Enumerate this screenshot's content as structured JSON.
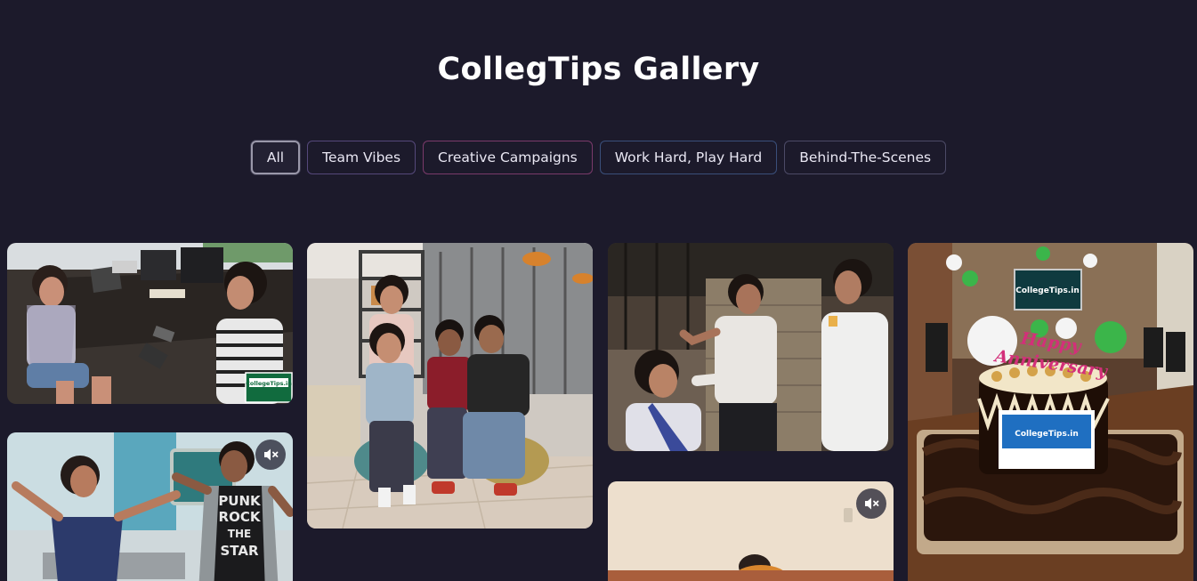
{
  "gallery": {
    "title": "CollegTips Gallery",
    "filters": [
      {
        "label": "All",
        "active": true
      },
      {
        "label": "Team Vibes",
        "active": false
      },
      {
        "label": "Creative Campaigns",
        "active": false
      },
      {
        "label": "Work Hard, Play Hard",
        "active": false
      },
      {
        "label": "Behind-The-Scenes",
        "active": false
      }
    ],
    "items": [
      {
        "type": "image",
        "subject": "two women at office desks with phones and laptops",
        "logo_text": "CollegeTips.in"
      },
      {
        "type": "video",
        "subject": "two women dancing in office",
        "muted": true,
        "shirt_text": "PUNK ROCK THE STAR"
      },
      {
        "type": "image",
        "subject": "five team members posing on poufs in lounge"
      },
      {
        "type": "image",
        "subject": "makeup session behind the scenes"
      },
      {
        "type": "video",
        "subject": "person in plain room",
        "muted": true
      },
      {
        "type": "image",
        "subject": "anniversary chocolate cake in conference room",
        "cake_topper": "Happy Anniversary",
        "cake_sign": "CollegeTips.in",
        "wall_sign": "CollegeTips.in"
      }
    ]
  },
  "icons": {
    "mute": "speaker-muted-icon"
  }
}
